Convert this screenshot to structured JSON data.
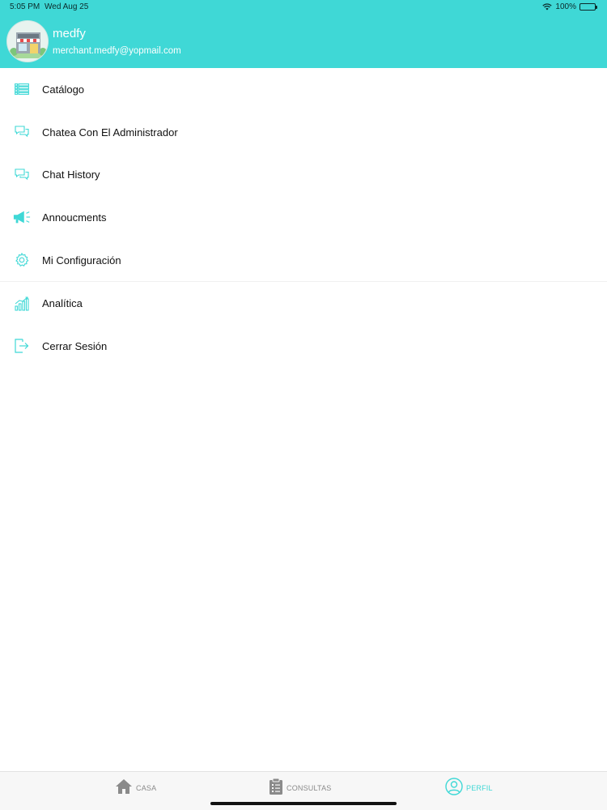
{
  "status_bar": {
    "time": "5:05 PM",
    "date": "Wed Aug 25",
    "battery": "100%"
  },
  "profile": {
    "name": "medfy",
    "email": "merchant.medfy@yopmail.com"
  },
  "menu": {
    "items": [
      {
        "label": "Catálogo",
        "icon": "list-icon"
      },
      {
        "label": "Chatea Con El Administrador",
        "icon": "chat-bubbles-icon"
      },
      {
        "label": "Chat History",
        "icon": "chat-bubbles-icon"
      },
      {
        "label": "Annoucments",
        "icon": "megaphone-icon"
      },
      {
        "label": "Mi Configuración",
        "icon": "gear-icon"
      },
      {
        "label": "Analítica",
        "icon": "bar-chart-icon"
      },
      {
        "label": "Cerrar Sesión",
        "icon": "logout-icon"
      }
    ]
  },
  "tabbar": {
    "tabs": [
      {
        "label": "CASA",
        "icon": "home-icon",
        "active": false
      },
      {
        "label": "CONSULTAS",
        "icon": "clipboard-icon",
        "active": false
      },
      {
        "label": "PERFIL",
        "icon": "user-circle-icon",
        "active": true
      }
    ]
  },
  "colors": {
    "accent": "#3fd8d6",
    "inactive_tab": "#8a8a8a",
    "active_tab": "#3fd8d6"
  }
}
